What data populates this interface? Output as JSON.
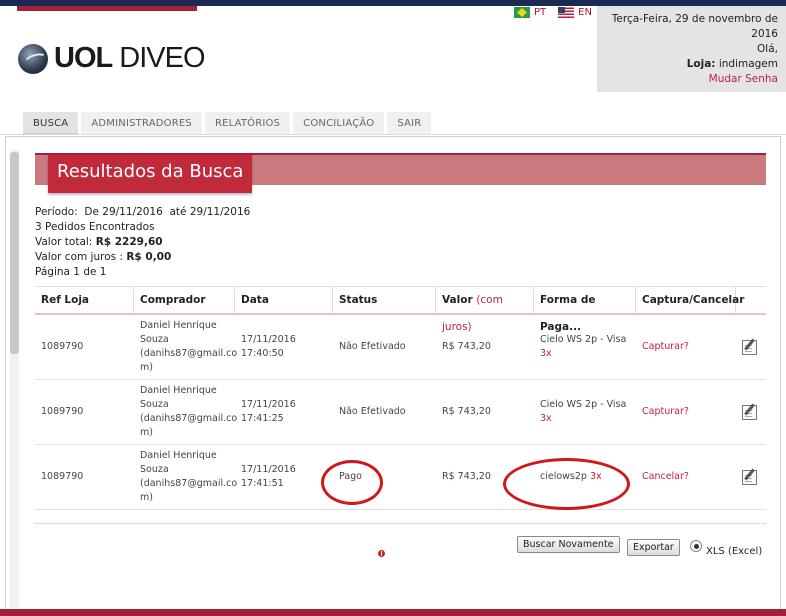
{
  "languages": [
    {
      "code": "PT",
      "flag": "flag-brazil-icon"
    },
    {
      "code": "EN",
      "flag": "flag-uk-icon"
    }
  ],
  "brand": {
    "logo_bold": "UOL",
    "logo_light": "DIVEO"
  },
  "user": {
    "date": "Terça-Feira, 29 de novembro de 2016",
    "greeting": "Olá,",
    "store_label": "Loja:",
    "store_value": "indimagem",
    "change_password": "Mudar Senha"
  },
  "tabs": [
    "BUSCA",
    "ADMINISTRADORES",
    "RELATÓRIOS",
    "CONCILIAÇÃO",
    "SAIR"
  ],
  "results": {
    "title": "Resultados da Busca",
    "period_label": "Período:",
    "period_from": "De 29/11/2016",
    "period_to": "até 29/11/2016",
    "orders_found": "3 Pedidos Encontrados",
    "total_label": "Valor total:",
    "total_value": "R$ 2229,60",
    "interest_label": "Valor com juros :",
    "interest_value": "R$ 0,00",
    "page_text": "Página 1   de 1"
  },
  "table": {
    "headers": {
      "ref": "Ref Loja",
      "buyer": "Comprador",
      "date": "Data",
      "status": "Status",
      "value": "Valor",
      "value_note": "(com juros)",
      "payment": "Forma de Paga...",
      "capture": "Captura/Cancelar"
    },
    "rows": [
      {
        "ref": "1089790",
        "buyer_name": "Daniel Henrique",
        "buyer_name2": "Souza",
        "buyer_email1": "(danihs87@gmail.co",
        "buyer_email2": "m)",
        "date": "17/11/2016",
        "time": "17:40:50",
        "status": "Não Efetivado",
        "value": "R$ 743,20",
        "payment": "Cielo WS 2p - Visa",
        "installments": "3x",
        "action": "Capturar?"
      },
      {
        "ref": "1089790",
        "buyer_name": "Daniel Henrique",
        "buyer_name2": "Souza",
        "buyer_email1": "(danihs87@gmail.co",
        "buyer_email2": "m)",
        "date": "17/11/2016",
        "time": "17:41:25",
        "status": "Não Efetivado",
        "value": "R$ 743,20",
        "payment": "Cielo WS 2p - Visa",
        "installments": "3x",
        "action": "Capturar?"
      },
      {
        "ref": "1089790",
        "buyer_name": "Daniel Henrique",
        "buyer_name2": "Souza",
        "buyer_email1": "(danihs87@gmail.co",
        "buyer_email2": "m)",
        "date": "17/11/2016",
        "time": "17:41:51",
        "status": "Pago",
        "value": "R$ 743,20",
        "payment": "cielows2p",
        "installments": "3x",
        "action": "Cancelar?"
      }
    ]
  },
  "actions": {
    "search_again": "Buscar Novamente",
    "export": "Exportar",
    "export_format": "XLS (Excel)"
  },
  "colors": {
    "accent": "#c12a3a",
    "link": "#c0213f",
    "navy": "#1b2a52",
    "annotation": "#d01818"
  }
}
